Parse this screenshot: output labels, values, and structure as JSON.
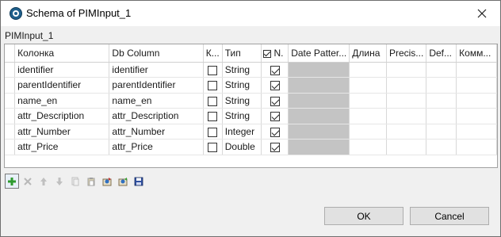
{
  "window": {
    "title": "Schema of PIMInput_1",
    "schema_name": "PIMInput_1"
  },
  "table": {
    "headers": [
      "Колонка",
      "Db Column",
      "К...",
      "Тип",
      "N.",
      "Date Patter...",
      "Длина",
      "Precis...",
      "Def...",
      "Комм..."
    ],
    "rows": [
      {
        "column": "identifier",
        "db_column": "identifier",
        "key": false,
        "type": "String",
        "nullable": true
      },
      {
        "column": "parentIdentifier",
        "db_column": "parentIdentifier",
        "key": false,
        "type": "String",
        "nullable": true
      },
      {
        "column": "name_en",
        "db_column": "name_en",
        "key": false,
        "type": "String",
        "nullable": true
      },
      {
        "column": "attr_Description",
        "db_column": "attr_Description",
        "key": false,
        "type": "String",
        "nullable": true
      },
      {
        "column": "attr_Number",
        "db_column": "attr_Number",
        "key": false,
        "type": "Integer",
        "nullable": true
      },
      {
        "column": "attr_Price",
        "db_column": "attr_Price",
        "key": false,
        "type": "Double",
        "nullable": true
      }
    ],
    "nullable_header_checked": true
  },
  "toolbar": {
    "buttons": [
      {
        "icon": "add-icon",
        "enabled": true
      },
      {
        "icon": "delete-icon",
        "enabled": false
      },
      {
        "icon": "move-up-icon",
        "enabled": false
      },
      {
        "icon": "move-down-icon",
        "enabled": false
      },
      {
        "icon": "copy-icon",
        "enabled": false
      },
      {
        "icon": "paste-icon",
        "enabled": false
      },
      {
        "icon": "import-icon",
        "enabled": true
      },
      {
        "icon": "export-icon",
        "enabled": true
      },
      {
        "icon": "save-icon",
        "enabled": true
      }
    ]
  },
  "buttons": {
    "ok": "OK",
    "cancel": "Cancel"
  }
}
